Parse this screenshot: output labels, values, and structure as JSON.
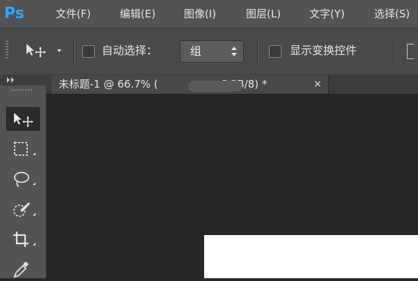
{
  "app": {
    "logo": "Ps"
  },
  "menu": [
    {
      "label": "文件(F)"
    },
    {
      "label": "编辑(E)"
    },
    {
      "label": "图像(I)"
    },
    {
      "label": "图层(L)"
    },
    {
      "label": "文字(Y)"
    },
    {
      "label": "选择(S)"
    }
  ],
  "options_bar": {
    "tool_preset_icon": "move-tool-icon",
    "auto_select_label": "自动选择：",
    "auto_select_checked": false,
    "auto_select_target": "组",
    "show_transform_label": "显示变换控件",
    "show_transform_checked": false
  },
  "tools": [
    {
      "name": "move-tool-icon",
      "active": true
    },
    {
      "name": "marquee-tool-icon",
      "active": false
    },
    {
      "name": "lasso-tool-icon",
      "active": false
    },
    {
      "name": "quick-selection-tool-icon",
      "active": false
    },
    {
      "name": "crop-tool-icon",
      "active": false
    },
    {
      "name": "eyedropper-tool-icon",
      "active": false
    }
  ],
  "document_tab": {
    "title": "未标题-1 @ 66.7% (",
    "title_suffix": ", RGB/8) *",
    "close": "×"
  },
  "colors": {
    "menubar": "#535353",
    "workspace": "#262626",
    "logo": "#31a8ff",
    "canvas": "#ffffff"
  }
}
